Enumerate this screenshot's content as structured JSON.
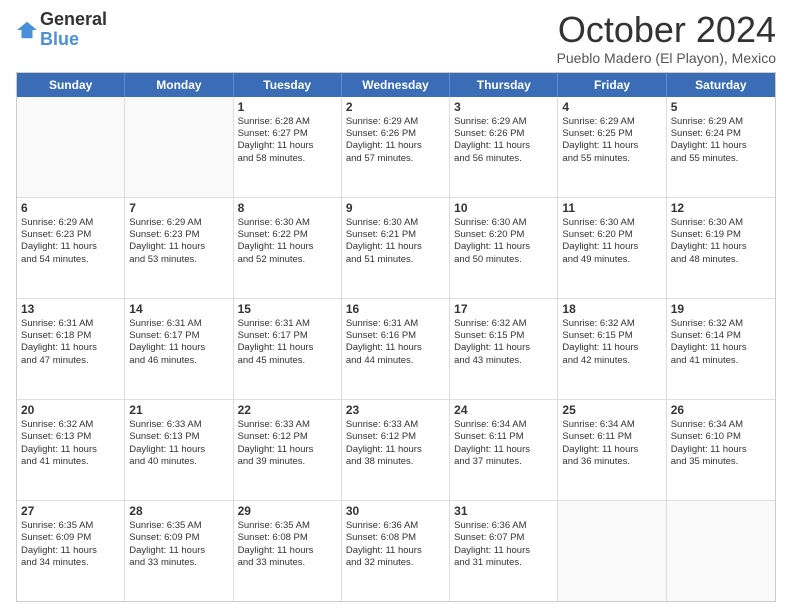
{
  "header": {
    "logo_line1": "General",
    "logo_line2": "Blue",
    "month_title": "October 2024",
    "location": "Pueblo Madero (El Playon), Mexico"
  },
  "calendar": {
    "days_of_week": [
      "Sunday",
      "Monday",
      "Tuesday",
      "Wednesday",
      "Thursday",
      "Friday",
      "Saturday"
    ],
    "weeks": [
      [
        {
          "day": "",
          "lines": [],
          "empty": true
        },
        {
          "day": "",
          "lines": [],
          "empty": true
        },
        {
          "day": "1",
          "lines": [
            "Sunrise: 6:28 AM",
            "Sunset: 6:27 PM",
            "Daylight: 11 hours",
            "and 58 minutes."
          ],
          "empty": false
        },
        {
          "day": "2",
          "lines": [
            "Sunrise: 6:29 AM",
            "Sunset: 6:26 PM",
            "Daylight: 11 hours",
            "and 57 minutes."
          ],
          "empty": false
        },
        {
          "day": "3",
          "lines": [
            "Sunrise: 6:29 AM",
            "Sunset: 6:26 PM",
            "Daylight: 11 hours",
            "and 56 minutes."
          ],
          "empty": false
        },
        {
          "day": "4",
          "lines": [
            "Sunrise: 6:29 AM",
            "Sunset: 6:25 PM",
            "Daylight: 11 hours",
            "and 55 minutes."
          ],
          "empty": false
        },
        {
          "day": "5",
          "lines": [
            "Sunrise: 6:29 AM",
            "Sunset: 6:24 PM",
            "Daylight: 11 hours",
            "and 55 minutes."
          ],
          "empty": false
        }
      ],
      [
        {
          "day": "6",
          "lines": [
            "Sunrise: 6:29 AM",
            "Sunset: 6:23 PM",
            "Daylight: 11 hours",
            "and 54 minutes."
          ],
          "empty": false
        },
        {
          "day": "7",
          "lines": [
            "Sunrise: 6:29 AM",
            "Sunset: 6:23 PM",
            "Daylight: 11 hours",
            "and 53 minutes."
          ],
          "empty": false
        },
        {
          "day": "8",
          "lines": [
            "Sunrise: 6:30 AM",
            "Sunset: 6:22 PM",
            "Daylight: 11 hours",
            "and 52 minutes."
          ],
          "empty": false
        },
        {
          "day": "9",
          "lines": [
            "Sunrise: 6:30 AM",
            "Sunset: 6:21 PM",
            "Daylight: 11 hours",
            "and 51 minutes."
          ],
          "empty": false
        },
        {
          "day": "10",
          "lines": [
            "Sunrise: 6:30 AM",
            "Sunset: 6:20 PM",
            "Daylight: 11 hours",
            "and 50 minutes."
          ],
          "empty": false
        },
        {
          "day": "11",
          "lines": [
            "Sunrise: 6:30 AM",
            "Sunset: 6:20 PM",
            "Daylight: 11 hours",
            "and 49 minutes."
          ],
          "empty": false
        },
        {
          "day": "12",
          "lines": [
            "Sunrise: 6:30 AM",
            "Sunset: 6:19 PM",
            "Daylight: 11 hours",
            "and 48 minutes."
          ],
          "empty": false
        }
      ],
      [
        {
          "day": "13",
          "lines": [
            "Sunrise: 6:31 AM",
            "Sunset: 6:18 PM",
            "Daylight: 11 hours",
            "and 47 minutes."
          ],
          "empty": false
        },
        {
          "day": "14",
          "lines": [
            "Sunrise: 6:31 AM",
            "Sunset: 6:17 PM",
            "Daylight: 11 hours",
            "and 46 minutes."
          ],
          "empty": false
        },
        {
          "day": "15",
          "lines": [
            "Sunrise: 6:31 AM",
            "Sunset: 6:17 PM",
            "Daylight: 11 hours",
            "and 45 minutes."
          ],
          "empty": false
        },
        {
          "day": "16",
          "lines": [
            "Sunrise: 6:31 AM",
            "Sunset: 6:16 PM",
            "Daylight: 11 hours",
            "and 44 minutes."
          ],
          "empty": false
        },
        {
          "day": "17",
          "lines": [
            "Sunrise: 6:32 AM",
            "Sunset: 6:15 PM",
            "Daylight: 11 hours",
            "and 43 minutes."
          ],
          "empty": false
        },
        {
          "day": "18",
          "lines": [
            "Sunrise: 6:32 AM",
            "Sunset: 6:15 PM",
            "Daylight: 11 hours",
            "and 42 minutes."
          ],
          "empty": false
        },
        {
          "day": "19",
          "lines": [
            "Sunrise: 6:32 AM",
            "Sunset: 6:14 PM",
            "Daylight: 11 hours",
            "and 41 minutes."
          ],
          "empty": false
        }
      ],
      [
        {
          "day": "20",
          "lines": [
            "Sunrise: 6:32 AM",
            "Sunset: 6:13 PM",
            "Daylight: 11 hours",
            "and 41 minutes."
          ],
          "empty": false
        },
        {
          "day": "21",
          "lines": [
            "Sunrise: 6:33 AM",
            "Sunset: 6:13 PM",
            "Daylight: 11 hours",
            "and 40 minutes."
          ],
          "empty": false
        },
        {
          "day": "22",
          "lines": [
            "Sunrise: 6:33 AM",
            "Sunset: 6:12 PM",
            "Daylight: 11 hours",
            "and 39 minutes."
          ],
          "empty": false
        },
        {
          "day": "23",
          "lines": [
            "Sunrise: 6:33 AM",
            "Sunset: 6:12 PM",
            "Daylight: 11 hours",
            "and 38 minutes."
          ],
          "empty": false
        },
        {
          "day": "24",
          "lines": [
            "Sunrise: 6:34 AM",
            "Sunset: 6:11 PM",
            "Daylight: 11 hours",
            "and 37 minutes."
          ],
          "empty": false
        },
        {
          "day": "25",
          "lines": [
            "Sunrise: 6:34 AM",
            "Sunset: 6:11 PM",
            "Daylight: 11 hours",
            "and 36 minutes."
          ],
          "empty": false
        },
        {
          "day": "26",
          "lines": [
            "Sunrise: 6:34 AM",
            "Sunset: 6:10 PM",
            "Daylight: 11 hours",
            "and 35 minutes."
          ],
          "empty": false
        }
      ],
      [
        {
          "day": "27",
          "lines": [
            "Sunrise: 6:35 AM",
            "Sunset: 6:09 PM",
            "Daylight: 11 hours",
            "and 34 minutes."
          ],
          "empty": false
        },
        {
          "day": "28",
          "lines": [
            "Sunrise: 6:35 AM",
            "Sunset: 6:09 PM",
            "Daylight: 11 hours",
            "and 33 minutes."
          ],
          "empty": false
        },
        {
          "day": "29",
          "lines": [
            "Sunrise: 6:35 AM",
            "Sunset: 6:08 PM",
            "Daylight: 11 hours",
            "and 33 minutes."
          ],
          "empty": false
        },
        {
          "day": "30",
          "lines": [
            "Sunrise: 6:36 AM",
            "Sunset: 6:08 PM",
            "Daylight: 11 hours",
            "and 32 minutes."
          ],
          "empty": false
        },
        {
          "day": "31",
          "lines": [
            "Sunrise: 6:36 AM",
            "Sunset: 6:07 PM",
            "Daylight: 11 hours",
            "and 31 minutes."
          ],
          "empty": false
        },
        {
          "day": "",
          "lines": [],
          "empty": true
        },
        {
          "day": "",
          "lines": [],
          "empty": true
        }
      ]
    ]
  }
}
